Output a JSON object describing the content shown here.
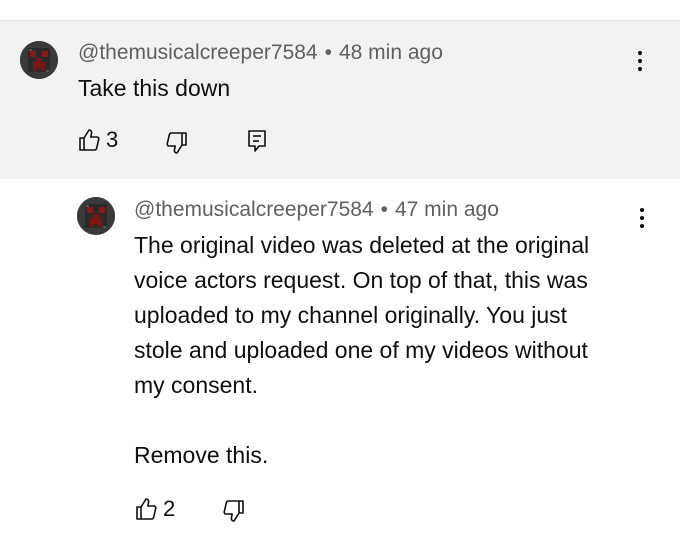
{
  "comment": {
    "author": "@themusicalcreeper7584",
    "separator": "•",
    "time": "48 min ago",
    "text": "Take this down",
    "like_count": "3",
    "icons": {
      "avatar": "creeper-avatar-icon",
      "menu": "more-vertical-icon",
      "like": "thumbs-up-icon",
      "dislike": "thumbs-down-icon",
      "reply": "reply-comment-icon"
    },
    "background": "#f2f2f2"
  },
  "reply": {
    "author": "@themusicalcreeper7584",
    "separator": "•",
    "time": "47 min ago",
    "text": "The original video was deleted at the original\nvoice actors request. On top of that, this was\nuploaded to my channel originally. You just\nstole and uploaded one of my videos without\nmy consent.\n\nRemove this.",
    "like_count": "2",
    "icons": {
      "avatar": "creeper-avatar-icon",
      "menu": "more-vertical-icon",
      "like": "thumbs-up-icon",
      "dislike": "thumbs-down-icon"
    }
  }
}
